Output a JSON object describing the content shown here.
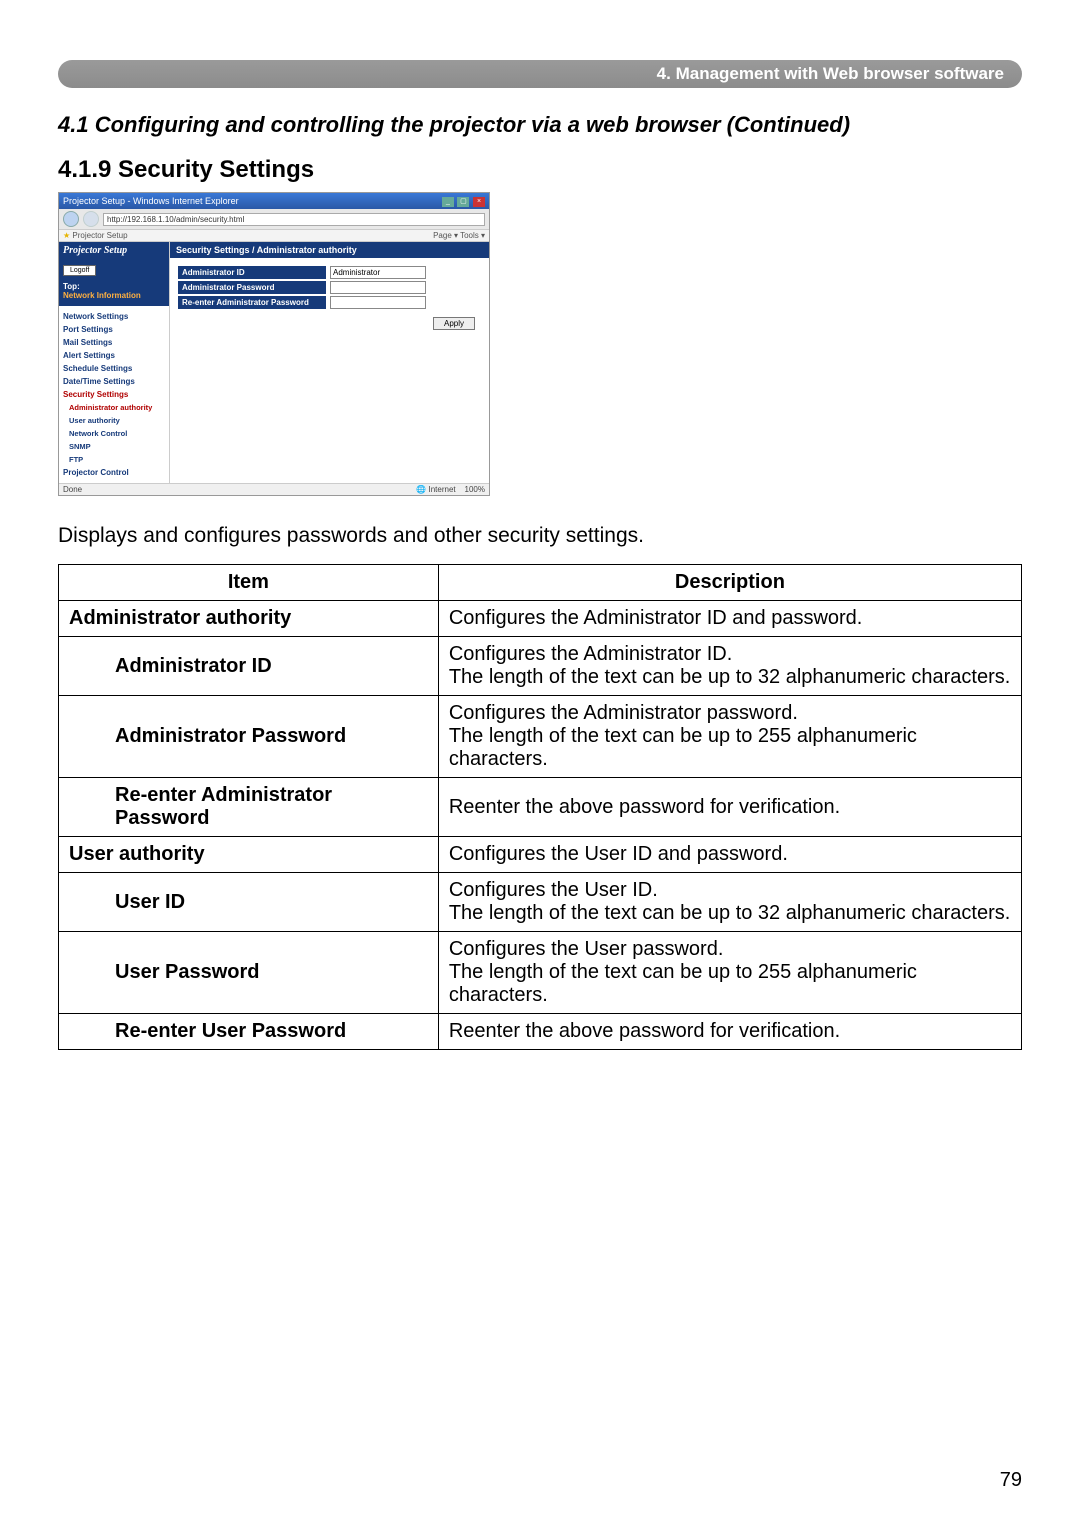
{
  "chapter_bar": "4. Management with Web browser software",
  "section_title": "4.1 Configuring and controlling the projector via a web browser (Continued)",
  "sub_title": "4.1.9 Security Settings",
  "intro_text": "Displays and configures passwords and other security settings.",
  "page_number": "79",
  "table": {
    "headers": {
      "item": "Item",
      "description": "Description"
    },
    "rows": [
      {
        "type": "main",
        "item": "Administrator authority",
        "desc": "Configures the Administrator ID and password."
      },
      {
        "type": "sub",
        "item": "Administrator ID",
        "desc": "Configures the Administrator ID.\nThe length of the text can be up to 32 alphanumeric characters."
      },
      {
        "type": "sub",
        "item": "Administrator Password",
        "desc": "Configures the Administrator password.\nThe length of the text can be up to 255 alphanumeric characters."
      },
      {
        "type": "sub",
        "item": "Re-enter Administrator Password",
        "desc": "Reenter the above password for verification."
      },
      {
        "type": "main",
        "item": "User authority",
        "desc": "Configures the User ID and password."
      },
      {
        "type": "sub",
        "item": "User ID",
        "desc": "Configures the User ID.\nThe length of the text can be up to 32 alphanumeric characters."
      },
      {
        "type": "sub",
        "item": "User Password",
        "desc": "Configures the User password.\nThe length of the text can be up to 255 alphanumeric characters."
      },
      {
        "type": "sub",
        "item": "Re-enter User Password",
        "desc": "Reenter the above password for verification."
      }
    ]
  },
  "screenshot": {
    "window_title": "Projector Setup - Windows Internet Explorer",
    "address": "http://192.168.1.10/admin/security.html",
    "fav_label": "Projector Setup",
    "toolbar_right": "Page ▾   Tools ▾",
    "side": {
      "logo": "Projector Setup",
      "logoff": "Logoff",
      "top": "Top:",
      "network_information": "Network Information",
      "nav": [
        "Network Settings",
        "Port Settings",
        "Mail Settings",
        "Alert Settings",
        "Schedule Settings",
        "Date/Time Settings",
        "Security Settings"
      ],
      "subnav": [
        "Administrator authority",
        "User authority",
        "Network Control",
        "SNMP",
        "FTP"
      ],
      "nav_bottom": "Projector Control"
    },
    "panel": {
      "title": "Security Settings / Administrator authority",
      "rows": [
        {
          "label": "Administrator ID",
          "value": "Administrator"
        },
        {
          "label": "Administrator Password",
          "value": ""
        },
        {
          "label": "Re-enter Administrator Password",
          "value": ""
        }
      ],
      "apply": "Apply"
    },
    "status": {
      "left": "Done",
      "internet": "Internet",
      "zoom": "100%"
    }
  }
}
